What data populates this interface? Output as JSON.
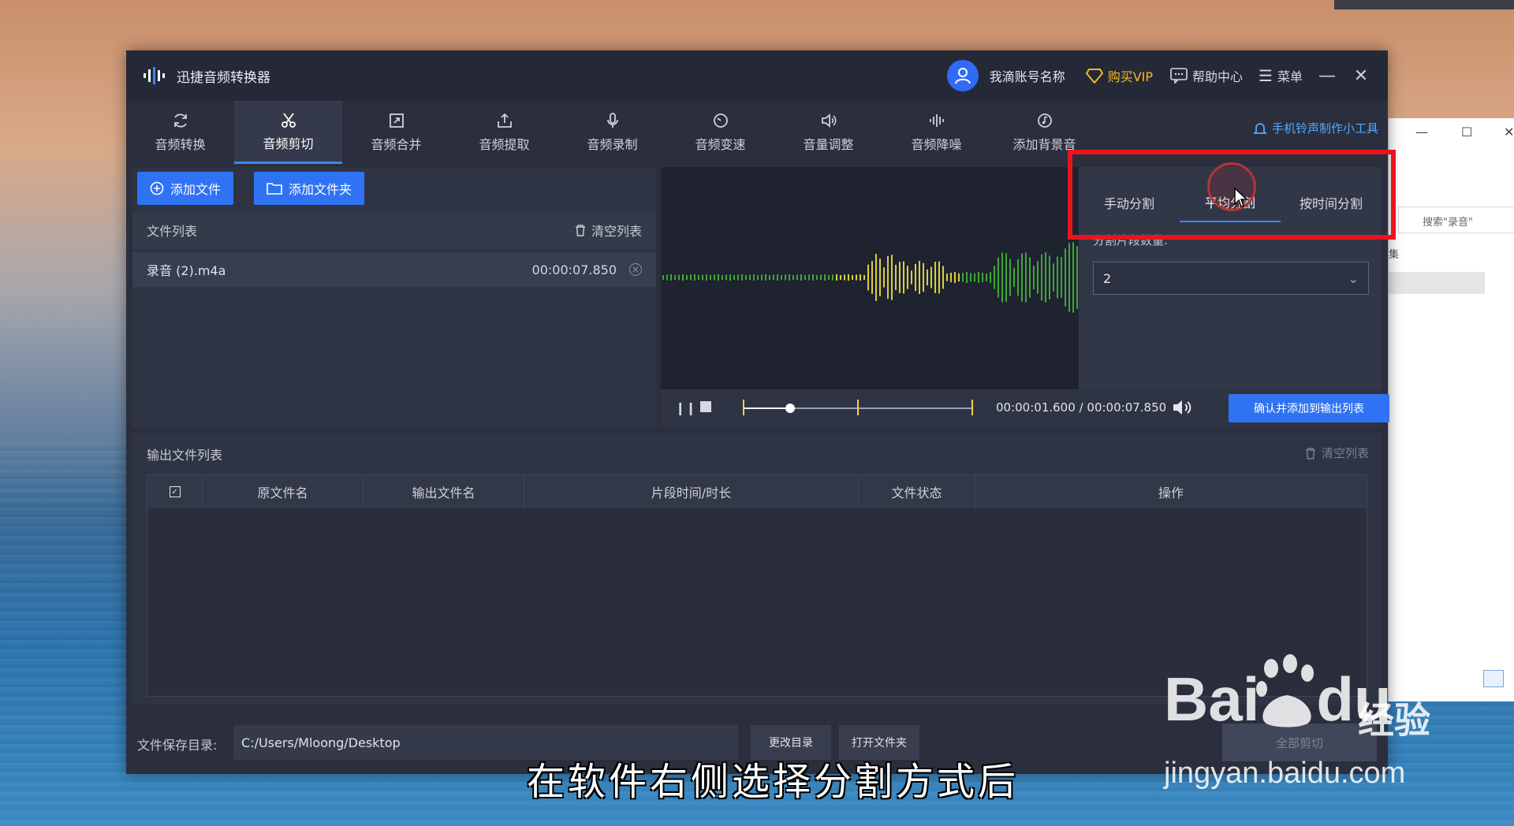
{
  "app": {
    "title": "迅捷音频转换器",
    "account": "我滴账号名称",
    "buy_vip": "购买VIP",
    "help": "帮助中心",
    "menu": "菜单",
    "minimize": "—",
    "close": "✕"
  },
  "nav": {
    "tabs": [
      {
        "label": "音频转换",
        "icon": "refresh-icon"
      },
      {
        "label": "音频剪切",
        "icon": "scissors-icon",
        "active": true
      },
      {
        "label": "音频合并",
        "icon": "merge-icon"
      },
      {
        "label": "音频提取",
        "icon": "upload-icon"
      },
      {
        "label": "音频录制",
        "icon": "microphone-icon"
      },
      {
        "label": "音频变速",
        "icon": "speed-icon"
      },
      {
        "label": "音量调整",
        "icon": "volume-icon"
      },
      {
        "label": "音频降噪",
        "icon": "equalizer-icon"
      },
      {
        "label": "添加背景音",
        "icon": "music-icon"
      }
    ],
    "ring_tool": "手机铃声制作小工具"
  },
  "files": {
    "add_file": "添加文件",
    "add_folder": "添加文件夹",
    "list_title": "文件列表",
    "clear_list": "清空列表",
    "items": [
      {
        "name": "录音 (2).m4a",
        "duration": "00:00:07.850"
      }
    ]
  },
  "split": {
    "tabs": [
      "手动分割",
      "平均分割",
      "按时间分割"
    ],
    "active_tab": "平均分割",
    "segment_label": "分割片段数量:",
    "segment_value": "2"
  },
  "player": {
    "current_time": "00:00:01.600",
    "separator": "/",
    "total_time": "00:00:07.850",
    "progress_fraction": 0.204,
    "confirm_button": "确认并添加到输出列表"
  },
  "output": {
    "title": "输出文件列表",
    "clear_list": "清空列表",
    "columns": [
      "原文件名",
      "输出文件名",
      "片段时间/时长",
      "文件状态",
      "操作"
    ]
  },
  "savebar": {
    "label": "文件保存目录:",
    "path": "C:/Users/Mloong/Desktop",
    "change_dir": "更改目录",
    "open_folder": "打开文件夹",
    "start": "全部剪切"
  },
  "explorer": {
    "search_placeholder": "搜索\"录音\"",
    "side_text": "集"
  },
  "overlay": {
    "subtitle": "在软件右侧选择分割方式后",
    "watermark_main": "Bai",
    "watermark_du": "du",
    "watermark_cn": "经验",
    "watermark_url": "jingyan.baidu.com"
  },
  "colors": {
    "accent": "#2f73f4",
    "vip": "#f5b81e",
    "highlight": "#e8141f",
    "wave_yellow": "#d8cf39",
    "wave_green": "#3fa637"
  }
}
